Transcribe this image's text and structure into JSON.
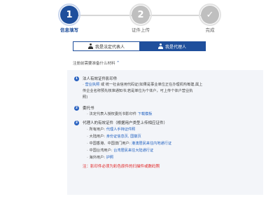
{
  "stepper": {
    "steps": [
      {
        "number": "1",
        "label": "信息填写",
        "state": "active"
      },
      {
        "number": "2",
        "label": "证件上传",
        "state": "pending"
      },
      {
        "number": "✓",
        "label": "完成",
        "state": "pending"
      }
    ],
    "colors": {
      "active": "#1f4f9c",
      "pending": "#bfbfbf"
    }
  },
  "tabs": [
    {
      "label": "我是法定代表人",
      "icon": "person-icon",
      "active": false
    },
    {
      "label": "我是代理人",
      "icon": "person-icon",
      "active": true
    }
  ],
  "hint": {
    "text": "注册前需要准备什么材料",
    "caret": "^"
  },
  "materials": {
    "items": [
      {
        "number": "1",
        "title": "法人有效证件影印件",
        "lines": [
          {
            "prefix": "- ",
            "link": "营业执照",
            "text": " 或 "
          },
          {
            "text": "统一社会信用代码证(如果是事业单位正在办理机构筹建,属上"
          },
          {
            "text": "传企业名称预先核准通知书;若是单位为个体户，可上传个体户营业执"
          },
          {
            "text": "照)"
          }
        ]
      },
      {
        "number": "2",
        "title": "委托书",
        "lines": [
          {
            "prefix": "- ",
            "text": "法定代表人授权委托书影印件 ",
            "link": "下载模板"
          }
        ]
      },
      {
        "number": "3",
        "title": "代理人的有效证件（根据用户类型上传相应证件）",
        "sub": [
          {
            "prefix": "- ",
            "label": "所有用户: ",
            "link": "代理人手持证件照"
          },
          {
            "prefix": "- ",
            "label": "大陆用户: ",
            "link": "身份证信息页, 国徽页"
          },
          {
            "prefix": "- ",
            "label": "中国香港、中国澳门用户: ",
            "link": "港澳居民来往内地通行证"
          },
          {
            "prefix": "- ",
            "label": "中国台湾用户: ",
            "link": "台湾居民来往大陆通行证"
          },
          {
            "prefix": "- ",
            "label": "海外用户: ",
            "link": "护照"
          }
        ]
      }
    ],
    "note": "注：影印件必须为彩色原件的扫描件或数码照"
  },
  "colors": {
    "accent": "#1f4f9c",
    "link": "#1f5fbf",
    "warning": "#e02020",
    "panel_bg": "#f3f5f9"
  }
}
